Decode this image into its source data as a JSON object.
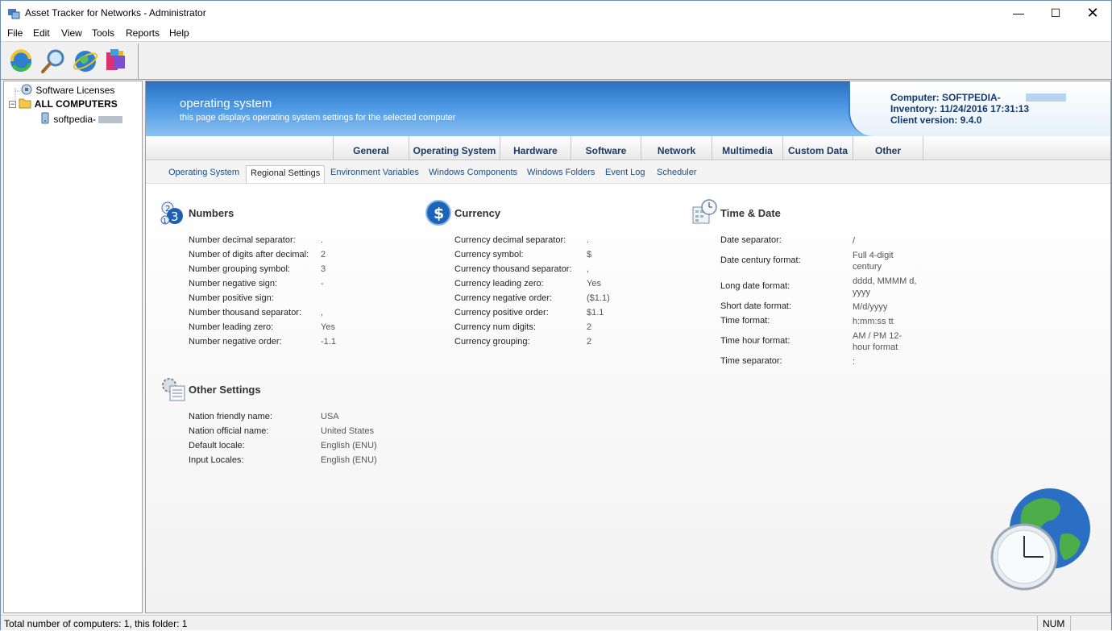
{
  "window": {
    "title": "Asset Tracker for Networks - Administrator"
  },
  "menu": [
    "File",
    "Edit",
    "View",
    "Tools",
    "Reports",
    "Help"
  ],
  "toolbar": {
    "buttons": [
      "refresh-icon",
      "search-icon",
      "globe-icon",
      "package-icon"
    ]
  },
  "tree": {
    "items": [
      {
        "label": "Software Licenses",
        "icon": "licenses-icon"
      },
      {
        "label": "ALL COMPUTERS",
        "icon": "folder-icon"
      },
      {
        "label": "softpedia-",
        "icon": "computer-icon"
      }
    ]
  },
  "banner": {
    "title": "operating system",
    "subtitle": "this page displays operating system settings for the selected computer",
    "computer": "Computer: SOFTPEDIA-",
    "inventory": "Inventory: 11/24/2016 17:31:13",
    "client_version": "Client version: 9.4.0"
  },
  "tabs": [
    "General",
    "Operating System",
    "Hardware",
    "Software",
    "Network",
    "Multimedia",
    "Custom Data",
    "Other"
  ],
  "subtabs": [
    "Operating System",
    "Regional Settings",
    "Environment Variables",
    "Windows Components",
    "Windows Folders",
    "Event Log",
    "Scheduler"
  ],
  "sections": {
    "numbers": {
      "title": "Numbers",
      "rows": [
        {
          "label": "Number decimal separator:",
          "value": "."
        },
        {
          "label": "Number of digits after decimal:",
          "value": "2"
        },
        {
          "label": "Number grouping symbol:",
          "value": "3"
        },
        {
          "label": "Number negative sign:",
          "value": "-"
        },
        {
          "label": "Number positive sign:",
          "value": ""
        },
        {
          "label": "Number thousand separator:",
          "value": ","
        },
        {
          "label": "Number leading zero:",
          "value": "Yes"
        },
        {
          "label": "Number negative order:",
          "value": "-1.1"
        }
      ]
    },
    "currency": {
      "title": "Currency",
      "rows": [
        {
          "label": "Currency decimal separator:",
          "value": "."
        },
        {
          "label": "Currency symbol:",
          "value": "$"
        },
        {
          "label": "Currency thousand separator:",
          "value": ","
        },
        {
          "label": "Currency leading zero:",
          "value": "Yes"
        },
        {
          "label": "Currency negative order:",
          "value": "($1.1)"
        },
        {
          "label": "Currency positive order:",
          "value": "$1.1"
        },
        {
          "label": "Currency num digits:",
          "value": "2"
        },
        {
          "label": "Currency grouping:",
          "value": "2"
        }
      ]
    },
    "timedate": {
      "title": "Time & Date",
      "rows": [
        {
          "label": "Date separator:",
          "value": "/"
        },
        {
          "label": "Date century format:",
          "value": "Full 4-digit century"
        },
        {
          "label": "Long date format:",
          "value": "dddd, MMMM d, yyyy"
        },
        {
          "label": "Short date format:",
          "value": "M/d/yyyy"
        },
        {
          "label": "Time format:",
          "value": "h:mm:ss tt"
        },
        {
          "label": "Time hour format:",
          "value": "AM / PM 12-hour format"
        },
        {
          "label": "Time separator:",
          "value": ":"
        }
      ]
    },
    "other": {
      "title": "Other Settings",
      "rows": [
        {
          "label": "Nation friendly name:",
          "value": "USA"
        },
        {
          "label": "Nation official name:",
          "value": "United States"
        },
        {
          "label": "Default locale:",
          "value": "English (ENU)"
        },
        {
          "label": "Input Locales:",
          "value": "English (ENU)"
        }
      ]
    }
  },
  "status": {
    "text": "Total number of computers: 1, this folder: 1",
    "num": "NUM"
  }
}
